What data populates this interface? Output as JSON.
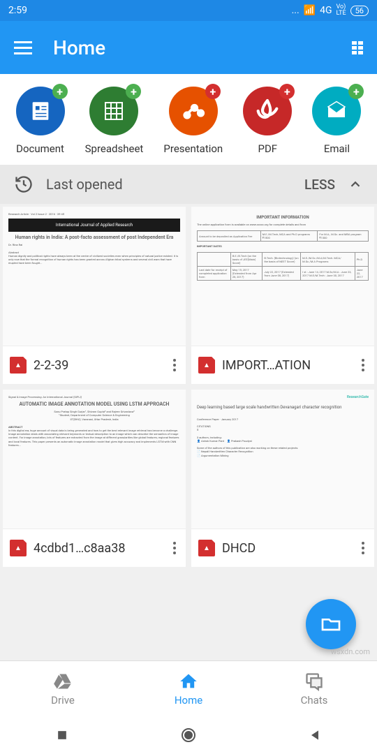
{
  "status": {
    "time": "2:59",
    "signal": "4G",
    "lte": "Vo)\nLTE",
    "battery": "56"
  },
  "appbar": {
    "title": "Home"
  },
  "quick": [
    {
      "label": "Document",
      "class": "qa-doc"
    },
    {
      "label": "Spreadsheet",
      "class": "qa-sheet"
    },
    {
      "label": "Presentation",
      "class": "qa-pres"
    },
    {
      "label": "PDF",
      "class": "qa-pdf"
    },
    {
      "label": "Email",
      "class": "qa-email"
    }
  ],
  "section": {
    "title": "Last opened",
    "toggle": "LESS"
  },
  "files": [
    {
      "name": "2-2-39",
      "thumb_banner": "International Journal of Applied Research",
      "thumb_title": "Human rights in India: A post-facto assessment of post Independent Era"
    },
    {
      "name": "IMPORT…ATION",
      "thumb_head": "IMPORTANT INFORMATION",
      "thumb_note": "The online application form is available on www.xxxxx.org for complete details and from"
    },
    {
      "name": "4cdbd1…c8aa38",
      "thumb_title": "AUTOMATIC IMAGE ANNOTATION MODEL USING LSTM APPROACH"
    },
    {
      "name": "DHCD",
      "thumb_title": "Deep learning based large scale handwritten Devanagari character recognition"
    }
  ],
  "nav": {
    "drive": "Drive",
    "home": "Home",
    "chats": "Chats"
  },
  "watermark": "wsxdn.com"
}
